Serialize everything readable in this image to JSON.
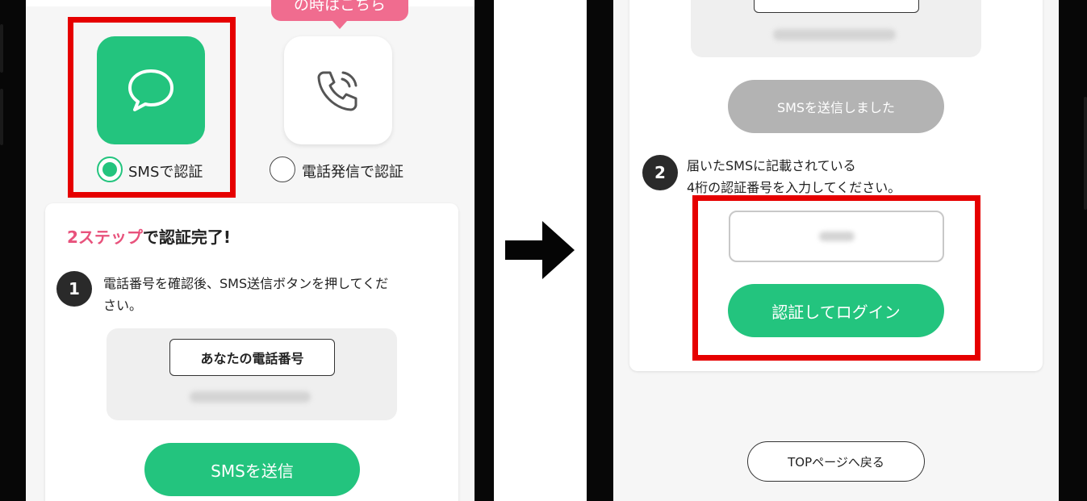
{
  "left_screen": {
    "method_tooltip": "の時はこちら",
    "options": {
      "sms": {
        "icon": "chat-bubble-icon",
        "label": "SMSで認証",
        "selected": true
      },
      "phone_call": {
        "icon": "phone-call-icon",
        "label": "電話発信で認証",
        "selected": false
      }
    },
    "card": {
      "heading_accent": "2ステップ",
      "heading_rest": "で認証完了!",
      "step1": {
        "number": "1",
        "line1": "電話番号を確認後、SMS送信ボタンを押してくだ",
        "line2": "さい。"
      },
      "phone_label": "あなたの電話番号",
      "send_button": "SMSを送信"
    }
  },
  "arrow": {
    "icon": "right-arrow-icon"
  },
  "right_screen": {
    "sent_button": "SMSを送信しました",
    "step2": {
      "number": "2",
      "line1": "届いたSMSに記載されている",
      "line2": "4桁の認証番号を入力してください。"
    },
    "login_button": "認証してログイン",
    "top_button": "TOPページへ戻る"
  },
  "colors": {
    "accent_green": "#23c47e",
    "accent_pink": "#e8527c",
    "highlight_red": "#e60000",
    "disabled_gray": "#b3b3b3"
  }
}
